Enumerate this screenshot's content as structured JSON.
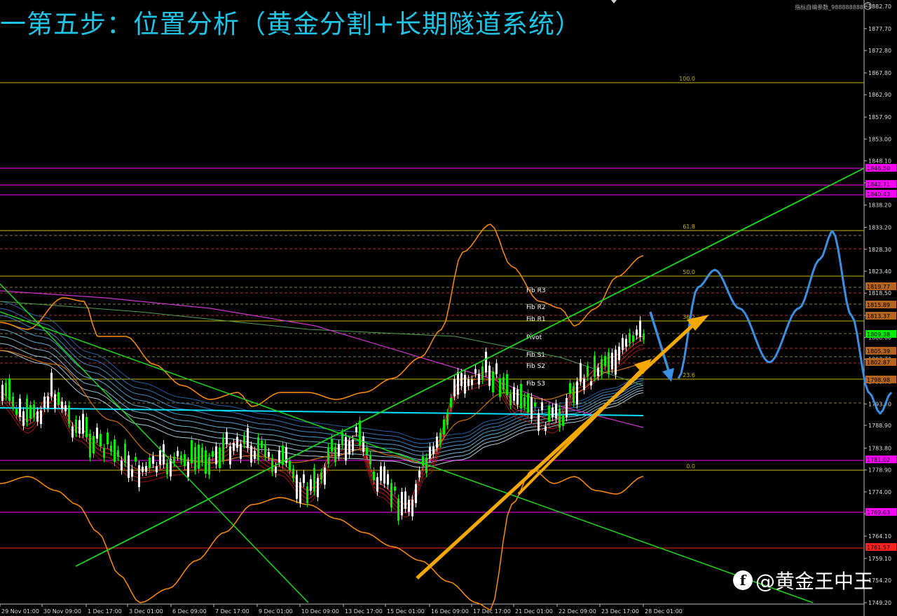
{
  "header": {
    "title": "一第五步：位置分析（黄金分割+长期隧道系统）",
    "info_text": "指标自编参数_988888888"
  },
  "watermark": {
    "icon": "facebook-like-icon",
    "text": "@黄金王中王"
  },
  "price_axis": {
    "labels": [
      "1882.70",
      "1877.70",
      "1872.80",
      "1867.80",
      "1862.90",
      "1857.90",
      "1853.00",
      "1848.10",
      "1843.20",
      "1838.20",
      "1833.20",
      "1828.30",
      "1823.40",
      "1818.50",
      "1813.50",
      "1808.60",
      "1803.70",
      "1798.70",
      "1793.70",
      "1788.90",
      "1783.80",
      "1778.90",
      "1774.00",
      "1769.10",
      "1764.10",
      "1759.10",
      "1754.20",
      "1749.20"
    ],
    "markers": [
      {
        "label": "1846.50",
        "color": "#ff00ff"
      },
      {
        "label": "1842.71",
        "color": "#ff00ff"
      },
      {
        "label": "1840.43",
        "color": "#ff00ff"
      },
      {
        "label": "1819.77",
        "color": "#b5651d"
      },
      {
        "label": "1815.89",
        "color": "#b5651d"
      },
      {
        "label": "1813.37",
        "color": "#b5651d"
      },
      {
        "label": "1809.38",
        "color": "#00ee00"
      },
      {
        "label": "1805.39",
        "color": "#b5651d"
      },
      {
        "label": "1802.87",
        "color": "#b5651d"
      },
      {
        "label": "1798.98",
        "color": "#b5651d"
      },
      {
        "label": "1781.02",
        "color": "#ff00ff"
      },
      {
        "label": "1769.63",
        "color": "#ff00ff"
      },
      {
        "label": "1761.57",
        "color": "#ff2020"
      }
    ]
  },
  "time_axis": {
    "labels": [
      "29 Nov 01:00",
      "30 Nov 09:00",
      "1 Dec 17:00",
      "3 Dec 01:00",
      "6 Dec 09:00",
      "7 Dec 17:00",
      "9 Dec 01:00",
      "10 Dec 09:00",
      "13 Dec 17:00",
      "15 Dec 01:00",
      "16 Dec 09:00",
      "17 Dec 17:00",
      "21 Dec 01:00",
      "22 Dec 09:00",
      "23 Dec 17:00",
      "28 Dec 01:00"
    ]
  },
  "fib_levels": [
    "100.0",
    "61.8",
    "50.0",
    "38.2",
    "23.6",
    "0.0"
  ],
  "pivot_labels": [
    "Fib R3",
    "Fib R2",
    "Fib R1",
    "Pivot",
    "Fib S1",
    "Fib S2",
    "Fib S3"
  ],
  "colors": {
    "title": "#1ec3e6",
    "fib": "#c8b400",
    "magenta": "#ff00ff",
    "trendline": "#18d818",
    "bollinger": "#ff8c00",
    "tunnel_line": "#00e0ff",
    "projection": "#3b8fe0",
    "arrow": "#f5a800",
    "bull_candle": "#00ee00",
    "bear_candle": "#ffffff"
  }
}
